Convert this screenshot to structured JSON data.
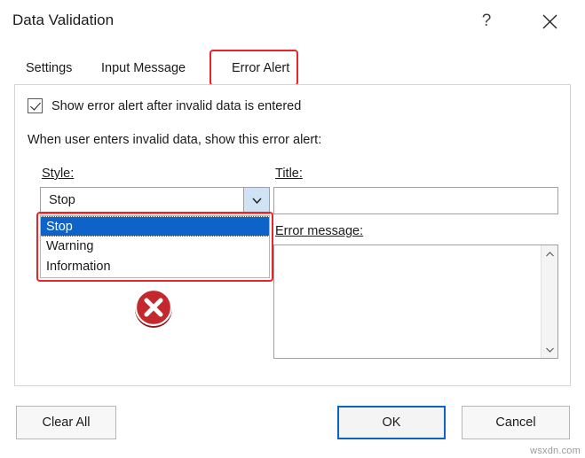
{
  "window": {
    "title": "Data Validation",
    "help_label": "?",
    "close_label": "close-icon"
  },
  "tabs": [
    {
      "label": "Settings",
      "selected": false
    },
    {
      "label": "Input Message",
      "selected": false
    },
    {
      "label": "Error Alert",
      "selected": true
    }
  ],
  "panel": {
    "checkbox": {
      "label": "Show error alert after invalid data is entered",
      "checked": true
    },
    "instruction": "When user enters invalid data, show this error alert:",
    "style": {
      "label": "Style:",
      "value": "Stop",
      "options": [
        "Stop",
        "Warning",
        "Information"
      ],
      "selected_option": "Stop"
    },
    "title_field": {
      "label": "Title:",
      "value": "",
      "placeholder": ""
    },
    "error_message_field": {
      "label": "Error message:",
      "value": "",
      "placeholder": ""
    },
    "icon_preview": "stop-error-icon"
  },
  "footer": {
    "clear_all": "Clear All",
    "ok": "OK",
    "cancel": "Cancel"
  },
  "watermark": "wsxdn.com",
  "colors": {
    "highlight_red": "#e8262a",
    "selection_blue": "#0e63c8",
    "accent_blue": "#0a64c8",
    "stop_red": "#c5282c"
  }
}
